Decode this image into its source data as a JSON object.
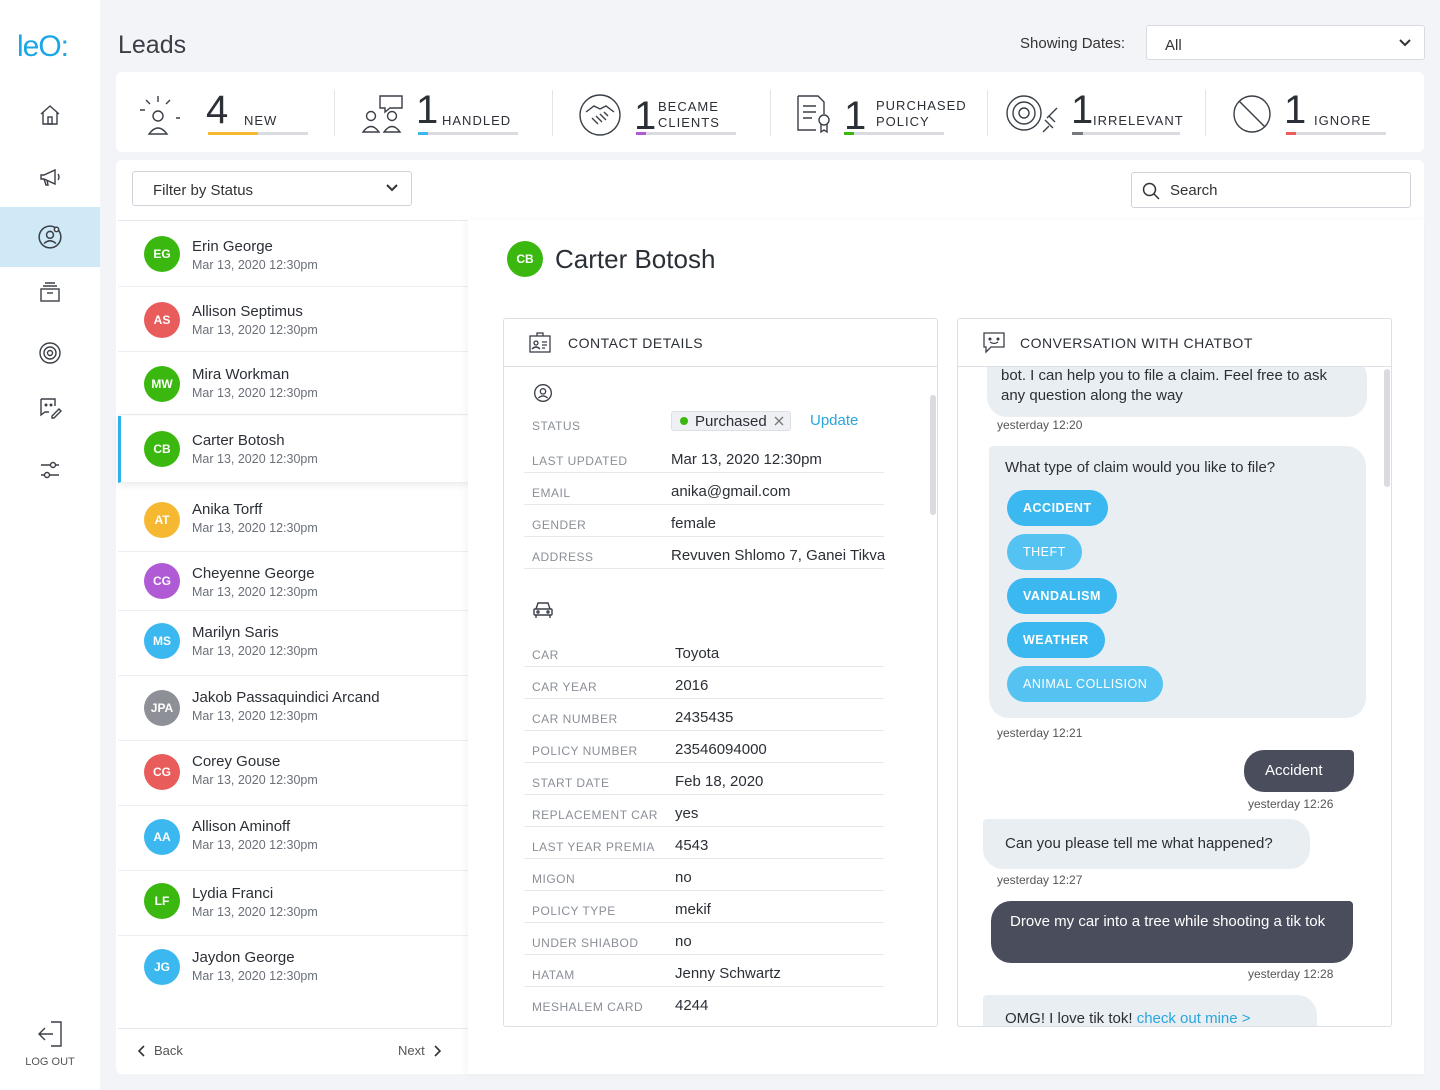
{
  "app": {
    "logo_text": "leO:",
    "page_title": "Leads",
    "logout_label": "LOG OUT"
  },
  "nav": {
    "items": [
      {
        "name": "home-icon",
        "active": false
      },
      {
        "name": "megaphone-icon",
        "active": false
      },
      {
        "name": "user-circle-icon",
        "active": true
      },
      {
        "name": "archive-icon",
        "active": false
      },
      {
        "name": "target-icon",
        "active": false
      },
      {
        "name": "chat-edit-icon",
        "active": false
      },
      {
        "name": "sliders-icon",
        "active": false
      }
    ]
  },
  "dates": {
    "label": "Showing Dates:",
    "value": "All"
  },
  "stats": [
    {
      "count": "4",
      "label1": "NEW",
      "label2": "",
      "color": "#f6b830",
      "fill": 0.5,
      "icon": "person-alert-icon"
    },
    {
      "count": "1",
      "label1": "HANDLED",
      "label2": "",
      "color": "#3bb8ef",
      "fill": 0.1,
      "icon": "people-chat-icon"
    },
    {
      "count": "1",
      "label1": "BECAME",
      "label2": "CLIENTS",
      "color": "#b05ad6",
      "fill": 0.1,
      "icon": "handshake-icon"
    },
    {
      "count": "1",
      "label1": "PURCHASED",
      "label2": "POLICY",
      "color": "#3ab80f",
      "fill": 0.1,
      "icon": "policy-document-icon"
    },
    {
      "count": "1",
      "label1": "IRRELEVANT",
      "label2": "",
      "color": "#777a80",
      "fill": 0.1,
      "icon": "target-plug-icon"
    },
    {
      "count": "1",
      "label1": "IGNORE",
      "label2": "",
      "color": "#e85c5c",
      "fill": 0.1,
      "icon": "ban-icon"
    }
  ],
  "filter": {
    "label": "Filter by Status"
  },
  "search": {
    "placeholder": "Search"
  },
  "leads": [
    {
      "initials": "EG",
      "name": "Erin George",
      "date": "Mar 13, 2020 12:30pm",
      "color": "#3ab80f"
    },
    {
      "initials": "AS",
      "name": "Allison Septimus",
      "date": "Mar 13, 2020 12:30pm",
      "color": "#e85c5c"
    },
    {
      "initials": "MW",
      "name": "Mira Workman",
      "date": "Mar 13, 2020 12:30pm",
      "color": "#3ab80f"
    },
    {
      "initials": "CB",
      "name": "Carter Botosh",
      "date": "Mar 13, 2020 12:30pm",
      "color": "#3ab80f"
    },
    {
      "initials": "AT",
      "name": "Anika Torff",
      "date": "Mar 13, 2020 12:30pm",
      "color": "#f6b830"
    },
    {
      "initials": "CG",
      "name": "Cheyenne George",
      "date": "Mar 13, 2020 12:30pm",
      "color": "#b05ad6"
    },
    {
      "initials": "MS",
      "name": "Marilyn Saris",
      "date": "Mar 13, 2020 12:30pm",
      "color": "#3bb8ef"
    },
    {
      "initials": "JPA",
      "name": "Jakob Passaquindici Arcand",
      "date": "Mar 13, 2020 12:30pm",
      "color": "#8d9096"
    },
    {
      "initials": "CG",
      "name": "Corey Gouse",
      "date": "Mar 13, 2020 12:30pm",
      "color": "#e85c5c"
    },
    {
      "initials": "AA",
      "name": "Allison Aminoff",
      "date": "Mar 13, 2020 12:30pm",
      "color": "#3bb8ef"
    },
    {
      "initials": "LF",
      "name": "Lydia Franci",
      "date": "Mar 13, 2020 12:30pm",
      "color": "#3ab80f"
    },
    {
      "initials": "JG",
      "name": "Jaydon George",
      "date": "Mar 13, 2020 12:30pm",
      "color": "#3bb8ef"
    }
  ],
  "pager": {
    "back": "Back",
    "next": "Next"
  },
  "detail": {
    "initials": "CB",
    "name": "Carter Botosh"
  },
  "contact": {
    "title": "CONTACT DETAILS",
    "status_label": "STATUS",
    "status_value": "Purchased",
    "update_label": "Update",
    "fields": [
      {
        "label": "LAST UPDATED",
        "value": "Mar 13, 2020 12:30pm"
      },
      {
        "label": "EMAIL",
        "value": "anika@gmail.com"
      },
      {
        "label": "GENDER",
        "value": "female"
      },
      {
        "label": "ADDRESS",
        "value": "Revuven Shlomo 7, Ganei Tikva"
      }
    ],
    "car_fields": [
      {
        "label": "CAR",
        "value": "Toyota"
      },
      {
        "label": "CAR YEAR",
        "value": "2016"
      },
      {
        "label": "CAR NUMBER",
        "value": "2435435"
      },
      {
        "label": "POLICY NUMBER",
        "value": "23546094000"
      },
      {
        "label": "START DATE",
        "value": "Feb 18, 2020"
      },
      {
        "label": "REPLACEMENT CAR",
        "value": "yes"
      },
      {
        "label": "LAST YEAR PREMIA",
        "value": "4543"
      },
      {
        "label": "MIGON",
        "value": "no"
      },
      {
        "label": "POLICY TYPE",
        "value": "mekif"
      },
      {
        "label": "UNDER SHIABOD",
        "value": "no"
      },
      {
        "label": "HATAM",
        "value": "Jenny Schwartz"
      },
      {
        "label": "MESHALEM CARD",
        "value": "4244"
      }
    ]
  },
  "chat": {
    "title": "CONVERSATION WITH CHATBOT",
    "m1": "bot. I can help you to file a claim. Feel free to ask any question along the way",
    "t1": "yesterday 12:20",
    "m2": "What type of claim would you like to file?",
    "options": [
      "ACCIDENT",
      "THEFT",
      "VANDALISM",
      "WEATHER",
      "ANIMAL COLLISION"
    ],
    "t2": "yesterday 12:21",
    "m3": "Accident",
    "t3": "yesterday 12:26",
    "m4": "Can you please tell me what happened?",
    "t4": "yesterday 12:27",
    "m5": "Drove my car into a tree while shooting a tik tok",
    "t5": "yesterday 12:28",
    "m6": "OMG! I love tik tok!",
    "m6_link": "check out mine >"
  }
}
